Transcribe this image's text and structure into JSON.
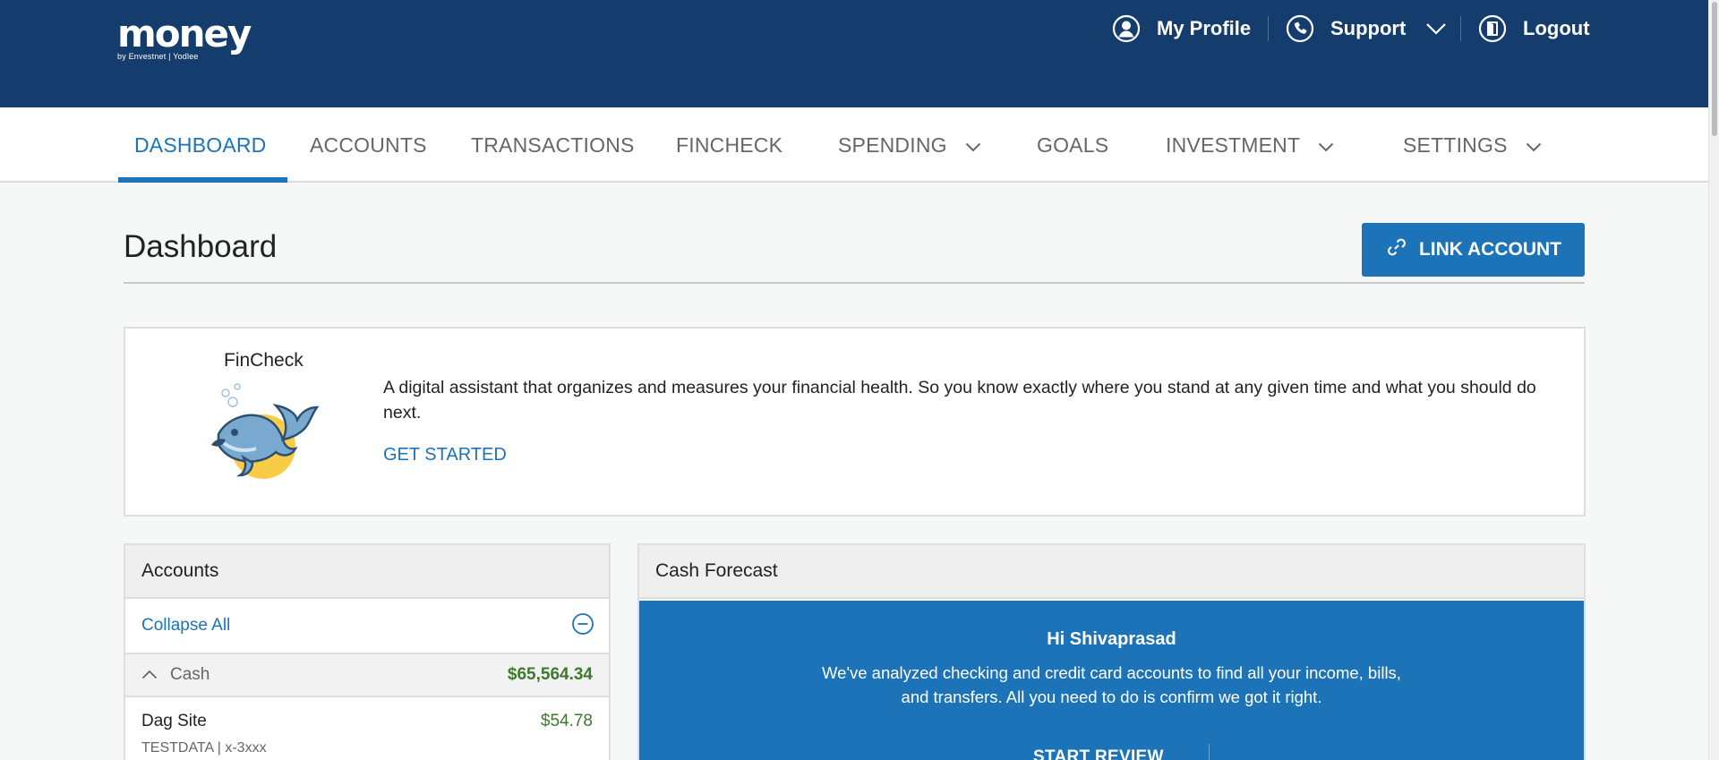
{
  "header": {
    "logo_word": "money",
    "logo_sub": "by Envestnet | Yodlee",
    "profile_label": "My Profile",
    "support_label": "Support",
    "logout_label": "Logout"
  },
  "nav": {
    "items": [
      {
        "label": "DASHBOARD",
        "active": true
      },
      {
        "label": "ACCOUNTS"
      },
      {
        "label": "TRANSACTIONS"
      },
      {
        "label": "FINCHECK"
      },
      {
        "label": "SPENDING",
        "dropdown": true
      },
      {
        "label": "GOALS"
      },
      {
        "label": "INVESTMENT",
        "dropdown": true
      },
      {
        "label": "SETTINGS",
        "dropdown": true
      }
    ]
  },
  "page": {
    "title": "Dashboard",
    "link_account_label": "LINK ACCOUNT"
  },
  "fincheck": {
    "title": "FinCheck",
    "description": "A digital assistant that organizes and measures your financial health. So you know exactly where you stand at any given time and what you should do next.",
    "cta": "GET STARTED"
  },
  "accounts": {
    "title": "Accounts",
    "collapse_label": "Collapse All",
    "group": {
      "label": "Cash",
      "total": "$65,564.34"
    },
    "rows": [
      {
        "name": "Dag Site",
        "balance": "$54.78",
        "sub": "TESTDATA | x-3xxx"
      }
    ]
  },
  "forecast": {
    "title": "Cash Forecast",
    "greeting": "Hi Shivaprasad",
    "message": "We've analyzed checking and credit card accounts to find all your income, bills, and transfers. All you need to do is confirm we got it right.",
    "cta": "START REVIEW"
  },
  "colors": {
    "header_bg": "#143d6e",
    "accent": "#1c73b8",
    "positive": "#3e7a2e"
  }
}
